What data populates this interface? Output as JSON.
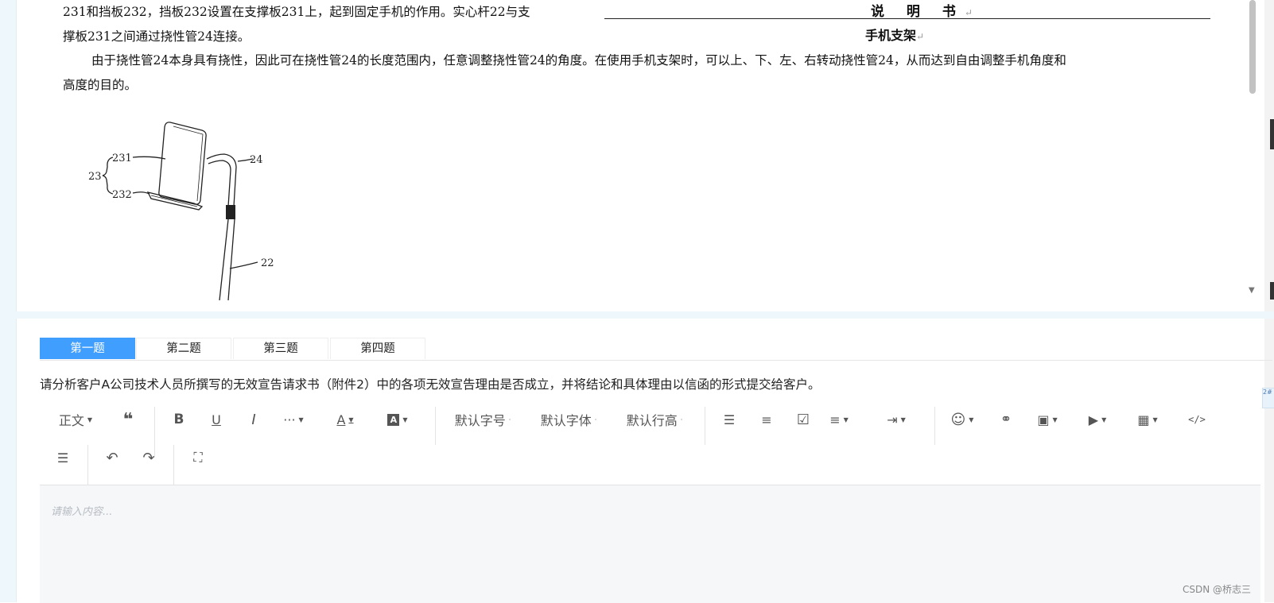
{
  "document": {
    "paragraph_lines": [
      "231和挡板232，挡板232设置在支撑板231上，起到固定手机的作用。实心杆22与支",
      "撑板231之间通过挠性管24连接。",
      "由于挠性管24本身具有挠性，因此可在挠性管24的长度范围内，任意调整挠性管24的角度。在使用手机支架时，可以上、下、左、右转动挠性管24，从而达到自由调整手机角度和",
      "高度的目的。"
    ],
    "title": "说 明 书",
    "subtitle": "手机支架",
    "return_mark": "↵",
    "figure_labels": {
      "label_231": "231",
      "label_232": "232",
      "label_23": "23",
      "label_24": "24",
      "label_22": "22"
    }
  },
  "tabs": [
    {
      "label": "第一题",
      "active": true
    },
    {
      "label": "第二题",
      "active": false
    },
    {
      "label": "第三题",
      "active": false
    },
    {
      "label": "第四题",
      "active": false
    }
  ],
  "question": "请分析客户A公司技术人员所撰写的无效宣告请求书（附件2）中的各项无效宣告理由是否成立，并将结论和具体理由以信函的形式提交给客户。",
  "toolbar": {
    "paragraph_style": "正文",
    "font_size": "默认字号",
    "font_family": "默认字体",
    "line_height": "默认行高",
    "icons": [
      "quote-icon",
      "bold-icon",
      "underline-icon",
      "italic-icon",
      "more-icon",
      "font-color-icon",
      "background-color-icon",
      "bulleted-list-icon",
      "numbered-list-icon",
      "todo-icon",
      "align-icon",
      "indent-icon",
      "emotion-icon",
      "link-icon",
      "image-icon",
      "video-icon",
      "table-icon",
      "code-icon",
      "divider-icon",
      "undo-icon",
      "redo-icon",
      "fullscreen-icon"
    ]
  },
  "editor": {
    "placeholder": "请输入内容..."
  },
  "edge_badge": "2#",
  "watermark": "CSDN @桥志三",
  "colors": {
    "accent": "#409eff",
    "editor_bg": "#f5f7f9",
    "side_strip": "#eef7fb"
  }
}
